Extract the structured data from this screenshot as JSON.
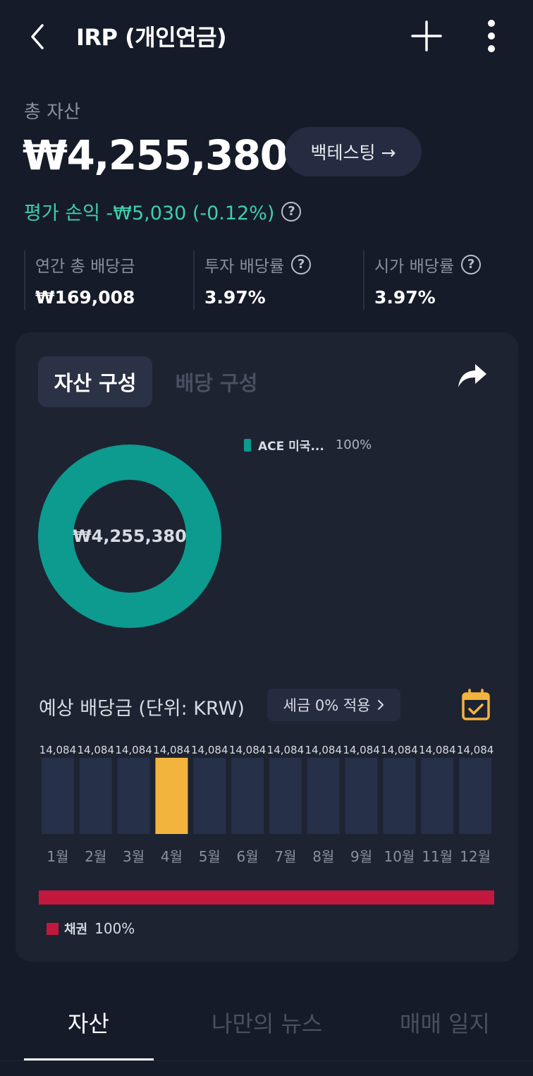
{
  "header": {
    "title": "IRP (개인연금)",
    "back_icon": "chevron-left-icon",
    "add_icon": "plus-icon",
    "more_icon": "vertical-dots-icon"
  },
  "summary": {
    "total_label": "총 자산",
    "total_value": "₩4,255,380",
    "backtest_label": "백테스팅 →",
    "pnl_text": "평가 손익 -₩5,030 (-0.12%)",
    "help_glyph": "?"
  },
  "stats": [
    {
      "label": "연간 총 배당금",
      "value": "₩169,008",
      "has_help": false
    },
    {
      "label": "투자 배당률",
      "value": "3.97%",
      "has_help": true
    },
    {
      "label": "시가 배당률",
      "value": "3.97%",
      "has_help": true
    }
  ],
  "card": {
    "tabs": [
      {
        "label": "자산 구성",
        "active": true
      },
      {
        "label": "배당 구성",
        "active": false
      }
    ],
    "share_icon": "share-arrow-icon",
    "composition": {
      "center_value": "₩4,255,380",
      "items": [
        {
          "name": "ACE 미국...",
          "percent": "100%",
          "share": 1.0,
          "color": "#0c9b8e"
        }
      ]
    },
    "dividend": {
      "title": "예상 배당금 (단위: KRW)",
      "tax_chip": "세금 0% 적용",
      "tax_chip_icon": "chevron-right-icon",
      "calendar_icon": "calendar-check-icon",
      "bar_color": "#263048",
      "highlight_color": "#f3b43e",
      "bond_label": "채권",
      "bond_percent": "100%",
      "bond_color": "#c3183d"
    }
  },
  "chart_data": {
    "type": "bar",
    "title": "예상 배당금 (단위: KRW)",
    "categories": [
      "1월",
      "2월",
      "3월",
      "4월",
      "5월",
      "6월",
      "7월",
      "8월",
      "9월",
      "10월",
      "11월",
      "12월"
    ],
    "values": [
      14084,
      14084,
      14084,
      14084,
      14084,
      14084,
      14084,
      14084,
      14084,
      14084,
      14084,
      14084
    ],
    "value_labels": [
      "14,084",
      "14,084",
      "14,084",
      "14,084",
      "14,084",
      "14,084",
      "14,084",
      "14,084",
      "14,084",
      "14,084",
      "14,084",
      "14,084"
    ],
    "highlight_index": 3,
    "ylim": [
      0,
      14084
    ],
    "grid": false
  },
  "bottom_tabs": [
    {
      "label": "자산",
      "active": true
    },
    {
      "label": "나만의 뉴스",
      "active": false
    },
    {
      "label": "매매 일지",
      "active": false
    }
  ]
}
